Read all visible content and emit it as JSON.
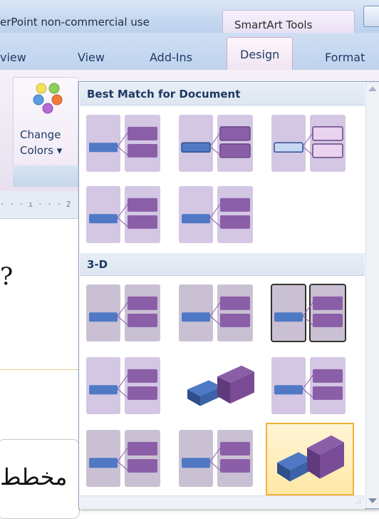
{
  "titlebar": {
    "title": "erPoint non-commercial use",
    "context_tab": "SmartArt Tools"
  },
  "ribbon_tabs": [
    {
      "label": "view"
    },
    {
      "label": "View"
    },
    {
      "label": "Add-Ins"
    },
    {
      "label": "Design",
      "active": true
    },
    {
      "label": "Format"
    }
  ],
  "ribbon": {
    "change_colors_line1": "Change",
    "change_colors_line2": "Colors ▾"
  },
  "document": {
    "ruler_text": "· · · ı · · · 2",
    "glyph": "?",
    "arabic_text": "مخطط"
  },
  "gallery": {
    "sections": [
      {
        "title": "Best Match for Document"
      },
      {
        "title": "3-D"
      }
    ],
    "selected_index": 13,
    "accent_colors": {
      "blue": "#4f79c4",
      "purple": "#8b5ea8",
      "lavender": "#d3c7e4",
      "selected_border": "#f0b23a"
    }
  }
}
